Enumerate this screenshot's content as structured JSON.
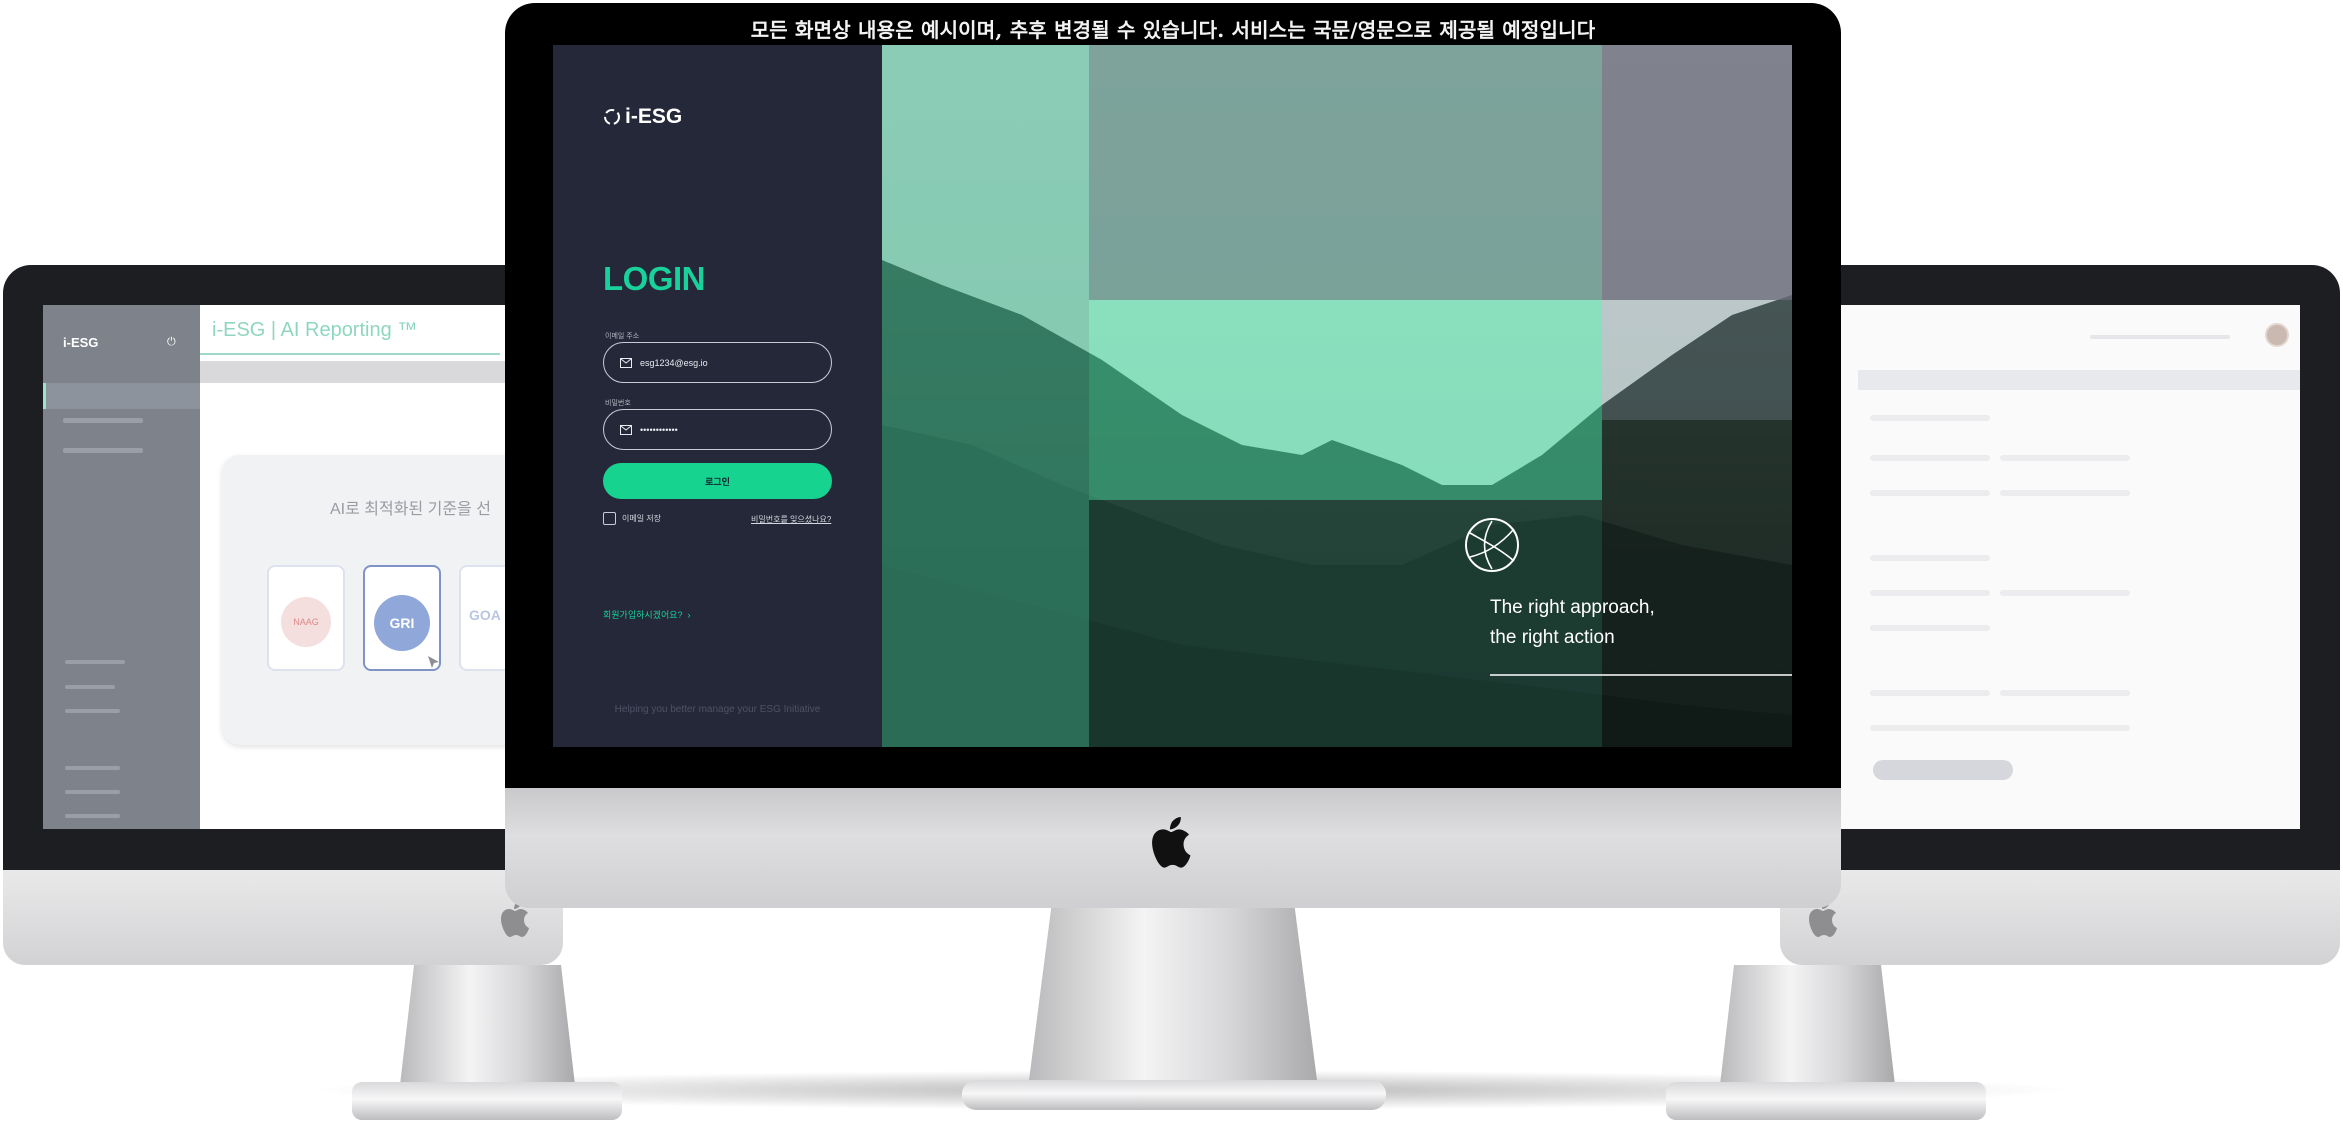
{
  "notice": "모든 화면상 내용은 예시이며, 추후 변경될 수 있습니다. 서비스는 국문/영문으로 제공될 예정입니다",
  "left_screen": {
    "logo": "i-ESG",
    "header_title": "i-ESG | AI Reporting ™",
    "card_heading": "AI로 최적화된 기준을 선",
    "standards": [
      "NAAG",
      "GRI",
      "GOA"
    ]
  },
  "center_screen": {
    "logo": "i-ESG",
    "title": "LOGIN",
    "email_label": "이메일 주소",
    "email_value": "esg1234@esg.io",
    "password_label": "비밀번호",
    "password_value": "••••••••••••",
    "login_button": "로그인",
    "remember_label": "이메일 저장",
    "forgot_link": "비밀번호를 잊으셨나요?",
    "signup_link": "회원가입하시겠어요?",
    "tagline": "Helping you better manage your ESG Initiative",
    "slogan_line1": "The right approach,",
    "slogan_line2": "the right action"
  },
  "colors": {
    "accent": "#16d48f",
    "panel": "#252838",
    "hero_overlay": "#7fe0b8"
  },
  "icons": [
    "i-esg-logo-icon",
    "mail-icon",
    "lock-icon",
    "chevron-right-icon",
    "apple-icon",
    "power-icon"
  ]
}
